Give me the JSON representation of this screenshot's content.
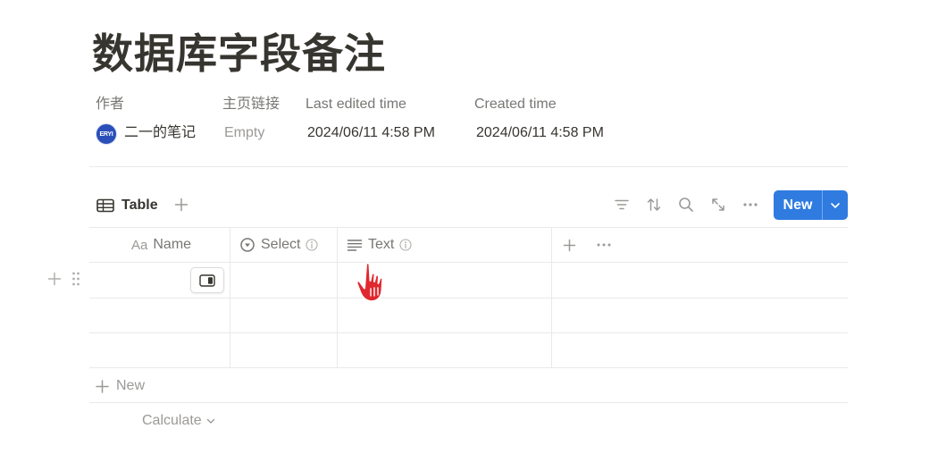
{
  "page": {
    "title": "数据库字段备注"
  },
  "properties": [
    {
      "label": "作者",
      "value": "二一的笔记",
      "avatar_text": "ERYI"
    },
    {
      "label": "主页链接",
      "value": "Empty"
    },
    {
      "label": "Last edited time",
      "value": "2024/06/11 4:58 PM"
    },
    {
      "label": "Created time",
      "value": "2024/06/11 4:58 PM"
    }
  ],
  "view": {
    "tab_label": "Table"
  },
  "toolbar": {
    "icons": [
      "filter-icon",
      "sort-icon",
      "search-icon",
      "expand-icon",
      "more-icon"
    ],
    "new_label": "New"
  },
  "table": {
    "columns": [
      {
        "prefix": "Aa",
        "label": "Name",
        "icon": "title-icon"
      },
      {
        "label": "Select",
        "icon": "select-icon"
      },
      {
        "label": "Text",
        "icon": "text-icon"
      }
    ],
    "rows": [
      [
        "",
        "",
        ""
      ],
      [
        "",
        "",
        ""
      ],
      [
        "",
        "",
        ""
      ]
    ],
    "new_row_label": "New",
    "calculate_label": "Calculate"
  },
  "colors": {
    "accent": "#2f7be0",
    "avatar": "#2a4fb8",
    "cursor": "#e0282e"
  }
}
